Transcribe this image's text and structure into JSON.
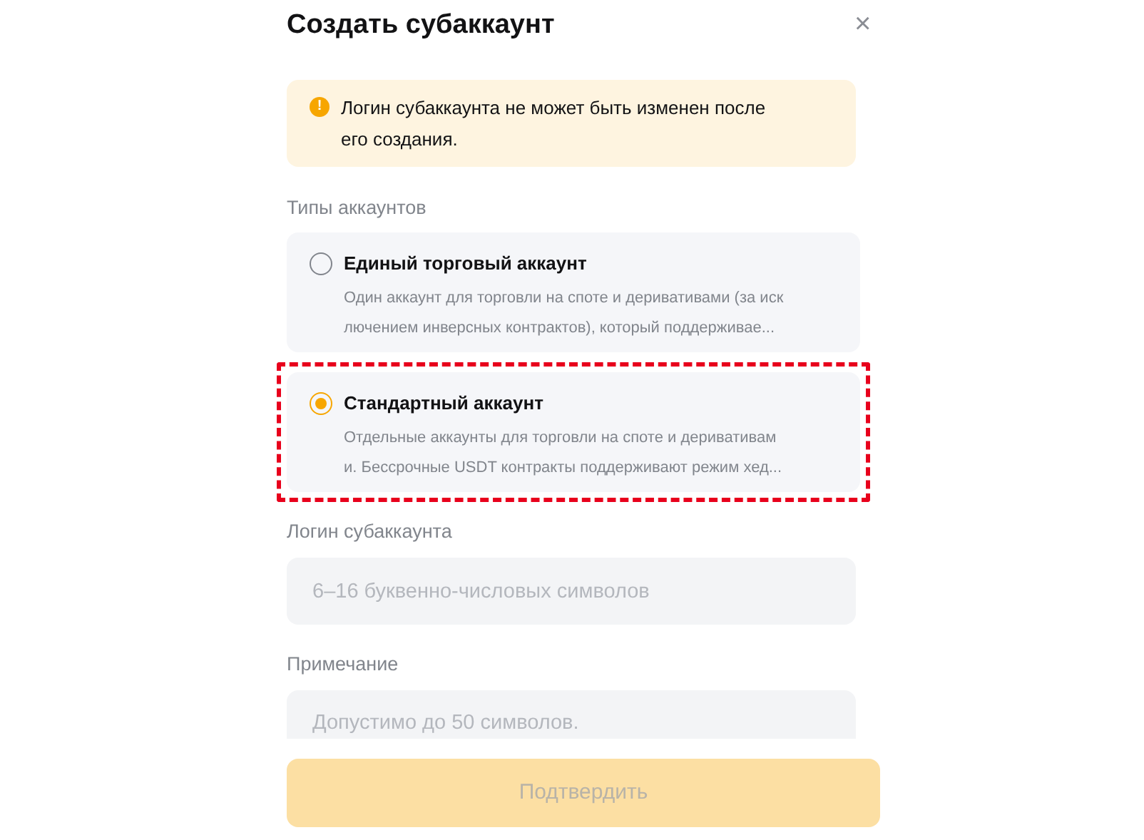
{
  "dialog": {
    "title": "Создать субаккаунт",
    "close": "×"
  },
  "notice": {
    "icon": "!",
    "text": "Логин субаккаунта не может быть изменен после его создания."
  },
  "account_types": {
    "label": "Типы аккаунтов",
    "options": [
      {
        "title": "Единый торговый аккаунт",
        "description_lines": [
          "Один аккаунт для торговли на споте и деривативами (за иск",
          "лючением инверсных контрактов), который поддерживае..."
        ],
        "selected": false,
        "highlighted": false
      },
      {
        "title": "Стандартный аккаунт",
        "description_lines": [
          "Отдельные аккаунты для торговли на споте и деривативам",
          "и. Бессрочные USDT контракты поддерживают режим хед..."
        ],
        "selected": true,
        "highlighted": true
      }
    ]
  },
  "login": {
    "label": "Логин субаккаунта",
    "placeholder": "6–16 буквенно-числовых символов"
  },
  "note": {
    "label": "Примечание",
    "placeholder": "Допустимо до 50 символов."
  },
  "confirm_button": {
    "label": "Подтвердить",
    "disabled": true
  }
}
